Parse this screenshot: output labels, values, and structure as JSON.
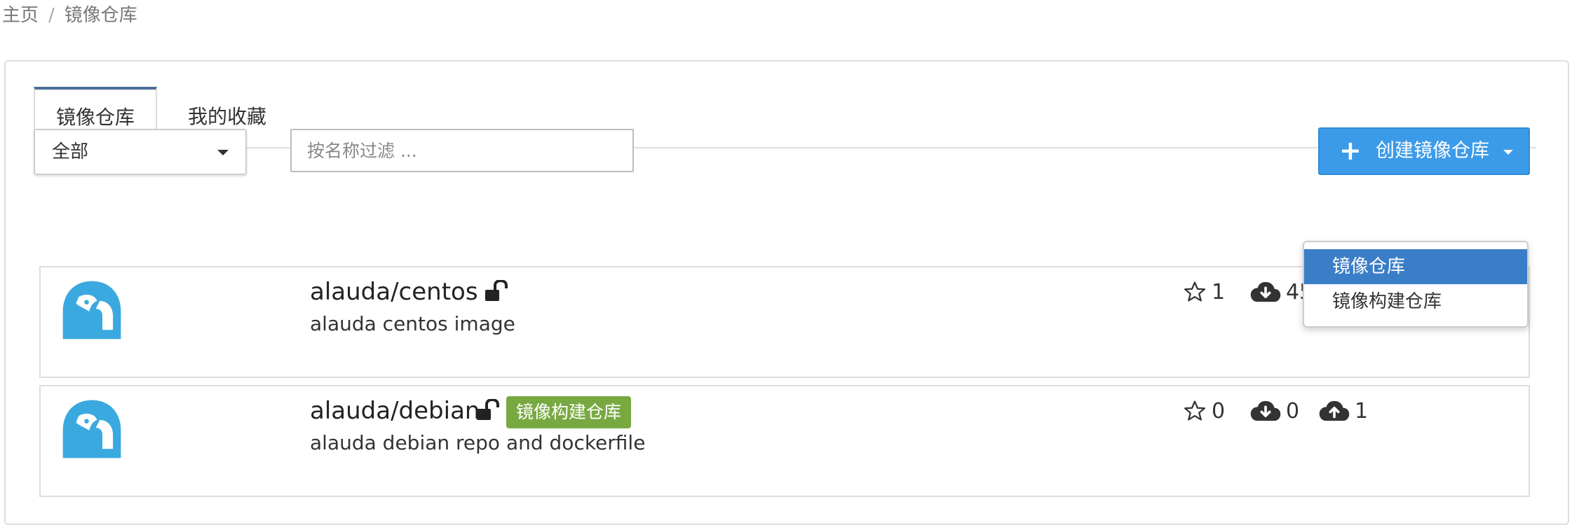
{
  "breadcrumb": {
    "home": "主页",
    "separator": "/",
    "current": "镜像仓库"
  },
  "tabs": [
    {
      "label": "镜像仓库",
      "active": true
    },
    {
      "label": "我的收藏",
      "active": false
    }
  ],
  "filter_bar": {
    "select_value": "全部",
    "search_placeholder": "按名称过滤 ...",
    "create_button_label": "创建镜像仓库"
  },
  "create_menu": {
    "items": [
      {
        "label": "镜像仓库",
        "highlighted": true
      },
      {
        "label": "镜像构建仓库",
        "highlighted": false
      }
    ]
  },
  "repos": [
    {
      "name": "alauda/centos",
      "description": "alauda centos image",
      "badge": "",
      "stars": "1",
      "downloads": "457",
      "uploads": ""
    },
    {
      "name": "alauda/debian",
      "description": "alauda debian repo and dockerfile",
      "badge": "镜像构建仓库",
      "stars": "0",
      "downloads": "0",
      "uploads": "1"
    }
  ],
  "colors": {
    "primary_button": "#3c9be9",
    "dropdown_highlight": "#3b7ec8",
    "badge_green": "#78a941",
    "logo_blue": "#3aa9e0",
    "tab_accent": "#4a6f96"
  },
  "icons": {
    "lock": "unlock-icon",
    "star": "star-outline-icon",
    "download": "cloud-download-icon",
    "upload": "cloud-upload-icon",
    "plus": "plus-icon",
    "logo": "alauda-bird-logo"
  }
}
